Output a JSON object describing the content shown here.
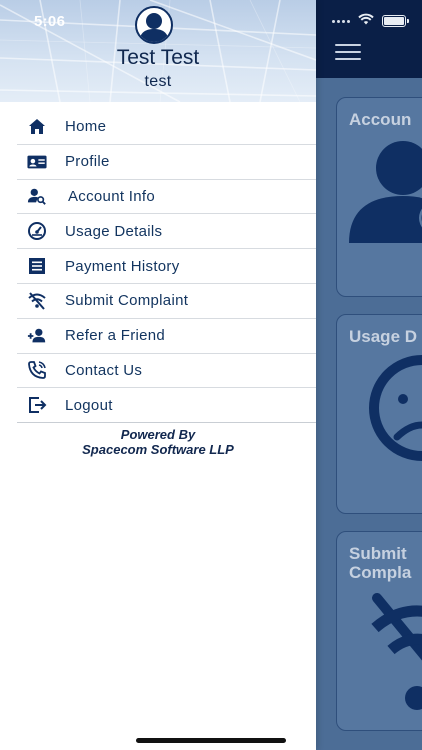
{
  "status_bar": {
    "time": "5:06"
  },
  "drawer": {
    "user_name": "Test Test",
    "user_sub": "test",
    "menu": [
      {
        "label": "Home",
        "icon": "home-icon"
      },
      {
        "label": "Profile",
        "icon": "id-card-icon"
      },
      {
        "label": "Account Info",
        "icon": "user-search-icon"
      },
      {
        "label": "Usage Details",
        "icon": "gauge-icon"
      },
      {
        "label": "Payment History",
        "icon": "receipt-icon"
      },
      {
        "label": "Submit Complaint",
        "icon": "no-wifi-icon"
      },
      {
        "label": "Refer a Friend",
        "icon": "add-user-icon"
      },
      {
        "label": "Contact Us",
        "icon": "phone-icon"
      },
      {
        "label": "Logout",
        "icon": "logout-icon"
      }
    ],
    "powered_by_line1": "Powered By",
    "powered_by_line2": "Spacecom Software LLP"
  },
  "background_cards": [
    {
      "title": "Accoun"
    },
    {
      "title": "Usage D"
    },
    {
      "title_line1": "Submit",
      "title_line2": "Compla"
    }
  ],
  "colors": {
    "drawer_text": "#12345f",
    "topbar": "#0a1f47",
    "overlay_bg": "#4c6d96"
  }
}
